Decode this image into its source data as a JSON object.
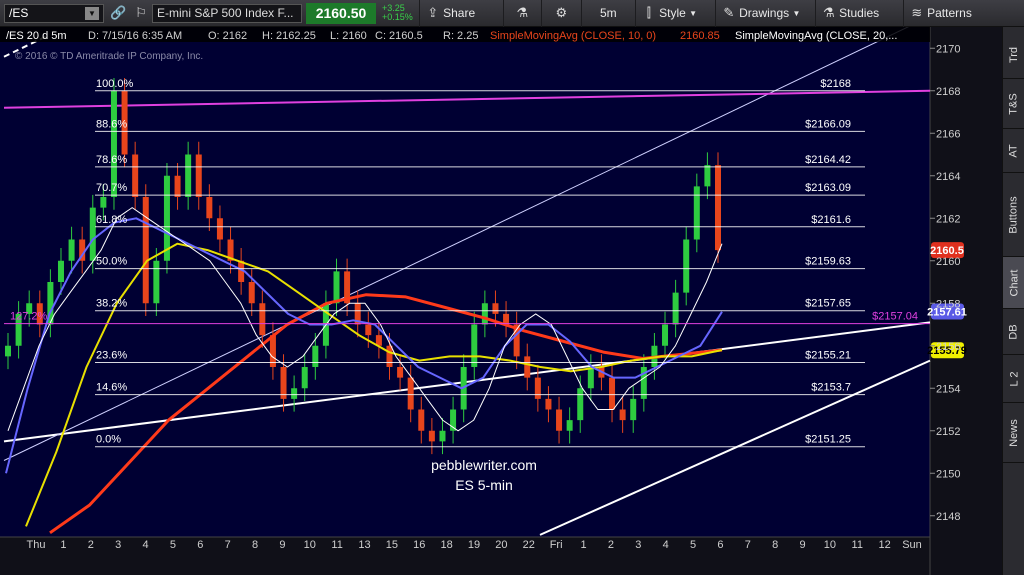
{
  "toolbar": {
    "symbol": "/ES",
    "description": "E-mini S&P 500 Index F...",
    "last_price": "2160.50",
    "change": "+3.25",
    "change_pct": "+0.15%",
    "share_label": "Share",
    "interval_label": "5m",
    "style_label": "Style",
    "drawings_label": "Drawings",
    "studies_label": "Studies",
    "patterns_label": "Patterns"
  },
  "header": {
    "symbol_period": "/ES 20 d 5m",
    "date": "D: 7/15/16 6:35 AM",
    "open": "O: 2162",
    "high": "H: 2162.25",
    "low": "L: 2160",
    "close": "C: 2160.5",
    "range": "R: 2.25",
    "study1": "SimpleMovingAvg (CLOSE, 10, 0)",
    "study1_value": "2160.85",
    "study2": "SimpleMovingAvg (CLOSE, 20,..."
  },
  "copyright": "© 2016 © TD Ameritrade IP Company, Inc.",
  "watermark": [
    "pebblewriter.com",
    "ES 5-min"
  ],
  "chart_data": {
    "type": "line",
    "symbol": "/ES",
    "y_range": [
      2147,
      2171
    ],
    "y_ticks": [
      2148,
      2150,
      2152,
      2154,
      2156,
      2158,
      2160,
      2162,
      2164,
      2166,
      2168,
      2170
    ],
    "x_ticks": [
      "Thu",
      "1",
      "2",
      "3",
      "4",
      "5",
      "6",
      "7",
      "8",
      "9",
      "10",
      "11",
      "13",
      "15",
      "16",
      "18",
      "19",
      "20",
      "22",
      "Fri",
      "1",
      "2",
      "3",
      "4",
      "5",
      "6",
      "7",
      "8",
      "9",
      "10",
      "11",
      "12",
      "Sun"
    ],
    "fib_levels": [
      {
        "pct": "100.0%",
        "price": 2168,
        "label": "$2168"
      },
      {
        "pct": "88.6%",
        "price": 2166.09,
        "label": "$2166.09"
      },
      {
        "pct": "78.6%",
        "price": 2164.42,
        "label": "$2164.42"
      },
      {
        "pct": "70.7%",
        "price": 2163.09,
        "label": "$2163.09"
      },
      {
        "pct": "61.8%",
        "price": 2161.6,
        "label": "$2161.6"
      },
      {
        "pct": "50.0%",
        "price": 2159.63,
        "label": "$2159.63"
      },
      {
        "pct": "38.2%",
        "price": 2157.65,
        "label": "$2157.65"
      },
      {
        "pct": "23.6%",
        "price": 2155.21,
        "label": "$2155.21"
      },
      {
        "pct": "14.6%",
        "price": 2153.7,
        "label": "$2153.7"
      },
      {
        "pct": "0.0%",
        "price": 2151.25,
        "label": "$2151.25"
      }
    ],
    "extension": {
      "pct": "127.2%",
      "price": 2157.04,
      "label": "$2157.04"
    },
    "price_markers": [
      {
        "value": "2160.5",
        "color": "#e0301e",
        "text_color": "#ffffff"
      },
      {
        "value": "2157.61",
        "color": "#5a5ae6",
        "text_color": "#ffffff"
      },
      {
        "value": "2155.79",
        "color": "#f0f000",
        "text_color": "#000000"
      }
    ],
    "colors": {
      "background": "#000033",
      "candle_up": "#2ecc40",
      "candle_down": "#e8451c",
      "sma10": "#ffffff",
      "sma20": "#6666ff",
      "sma50": "#e8e000",
      "sma200": "#ff3a1a",
      "magenta": "#e040e0",
      "fib": "#ffffff"
    },
    "candles": [
      2156,
      2157.5,
      2158,
      2157,
      2159,
      2160,
      2161,
      2160,
      2162.5,
      2163,
      2168,
      2165,
      2163,
      2158,
      2160,
      2164,
      2163,
      2165,
      2163,
      2162,
      2161,
      2160,
      2159,
      2158,
      2156.5,
      2155,
      2153.5,
      2154,
      2155,
      2156,
      2158,
      2159.5,
      2158,
      2157,
      2156.5,
      2156,
      2155,
      2154.5,
      2153,
      2152,
      2151.5,
      2152,
      2153,
      2155,
      2157,
      2158,
      2157.5,
      2157,
      2155.5,
      2154.5,
      2153.5,
      2153,
      2152,
      2152.5,
      2154,
      2155,
      2154.5,
      2153,
      2152.5,
      2153.5,
      2155,
      2156,
      2157,
      2158.5,
      2161,
      2163.5,
      2164.5,
      2160.5
    ],
    "sma10": [
      2152,
      2154,
      2156,
      2157.5,
      2158.5,
      2159.5,
      2160.5,
      2162,
      2162.5,
      2162,
      2161.5,
      2161,
      2160.5,
      2160,
      2159,
      2158,
      2156.5,
      2155.5,
      2155,
      2155.5,
      2156.5,
      2157.5,
      2158,
      2158,
      2157,
      2155.5,
      2154.5,
      2153.5,
      2152.5,
      2152,
      2152.5,
      2154,
      2156,
      2157,
      2157.5,
      2157,
      2155.5,
      2154,
      2153,
      2153,
      2154,
      2154.5,
      2155,
      2156,
      2157.5,
      2159,
      2160.8
    ],
    "sma20": [
      2150,
      2154,
      2157.5,
      2159.5,
      2161,
      2161.8,
      2162,
      2161.5,
      2161,
      2160.5,
      2160,
      2159.5,
      2158.5,
      2157.5,
      2157,
      2157,
      2157.2,
      2157,
      2156,
      2155,
      2154.5,
      2154,
      2154.5,
      2156,
      2157,
      2157,
      2156.2,
      2155,
      2154.5,
      2154.5,
      2155,
      2155.5,
      2156,
      2157.6
    ],
    "sma50": [
      2147.5,
      2151,
      2155,
      2158,
      2160,
      2160.8,
      2160.5,
      2160,
      2159.5,
      2158.5,
      2157.5,
      2156.5,
      2155.7,
      2155.3,
      2155.5,
      2155.5,
      2155.3,
      2155,
      2154.8,
      2155,
      2155.3,
      2155.5,
      2155.5,
      2155.8
    ],
    "sma200": [
      2147.2,
      2148.5,
      2150.5,
      2152.5,
      2154,
      2155.5,
      2157,
      2158,
      2158.4,
      2158.3,
      2157.8,
      2157.3,
      2156.7,
      2156.2,
      2155.7,
      2155.4,
      2155.6,
      2155.8
    ]
  },
  "right_tabs": [
    "Trd",
    "T&S",
    "AT",
    "Buttons",
    "Chart",
    "DB",
    "L 2",
    "News"
  ]
}
